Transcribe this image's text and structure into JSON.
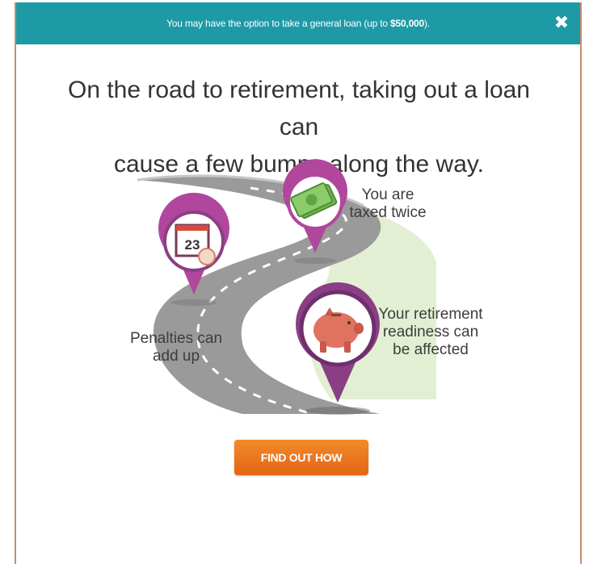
{
  "banner": {
    "message_prefix": "You may have the option to take a general loan (up to ",
    "message_amount": "$50,000",
    "message_suffix": ").",
    "close_label": "✖"
  },
  "headline": {
    "line1": "On the road to retirement, taking out a loan can",
    "line2": "cause a few bumps along the way."
  },
  "illustration": {
    "calendar_day": "23",
    "captions": {
      "taxed_line1": "You are",
      "taxed_line2": "taxed twice",
      "penalties_line1": "Penalties can",
      "penalties_line2": "add up",
      "retirement_line1": "Your retirement",
      "retirement_line2": "readiness can",
      "retirement_line3": "be affected"
    }
  },
  "cta": {
    "label": "FIND OUT HOW"
  },
  "colors": {
    "banner": "#1e9aa6",
    "cta": "#e8721c",
    "pin_purple": "#8a3f85",
    "pin_magenta": "#b0479c",
    "road": "#9a9a9a",
    "grass": "#e3efd3"
  },
  "icons": [
    "close-icon",
    "calendar-icon",
    "money-icon",
    "piggy-bank-icon"
  ]
}
